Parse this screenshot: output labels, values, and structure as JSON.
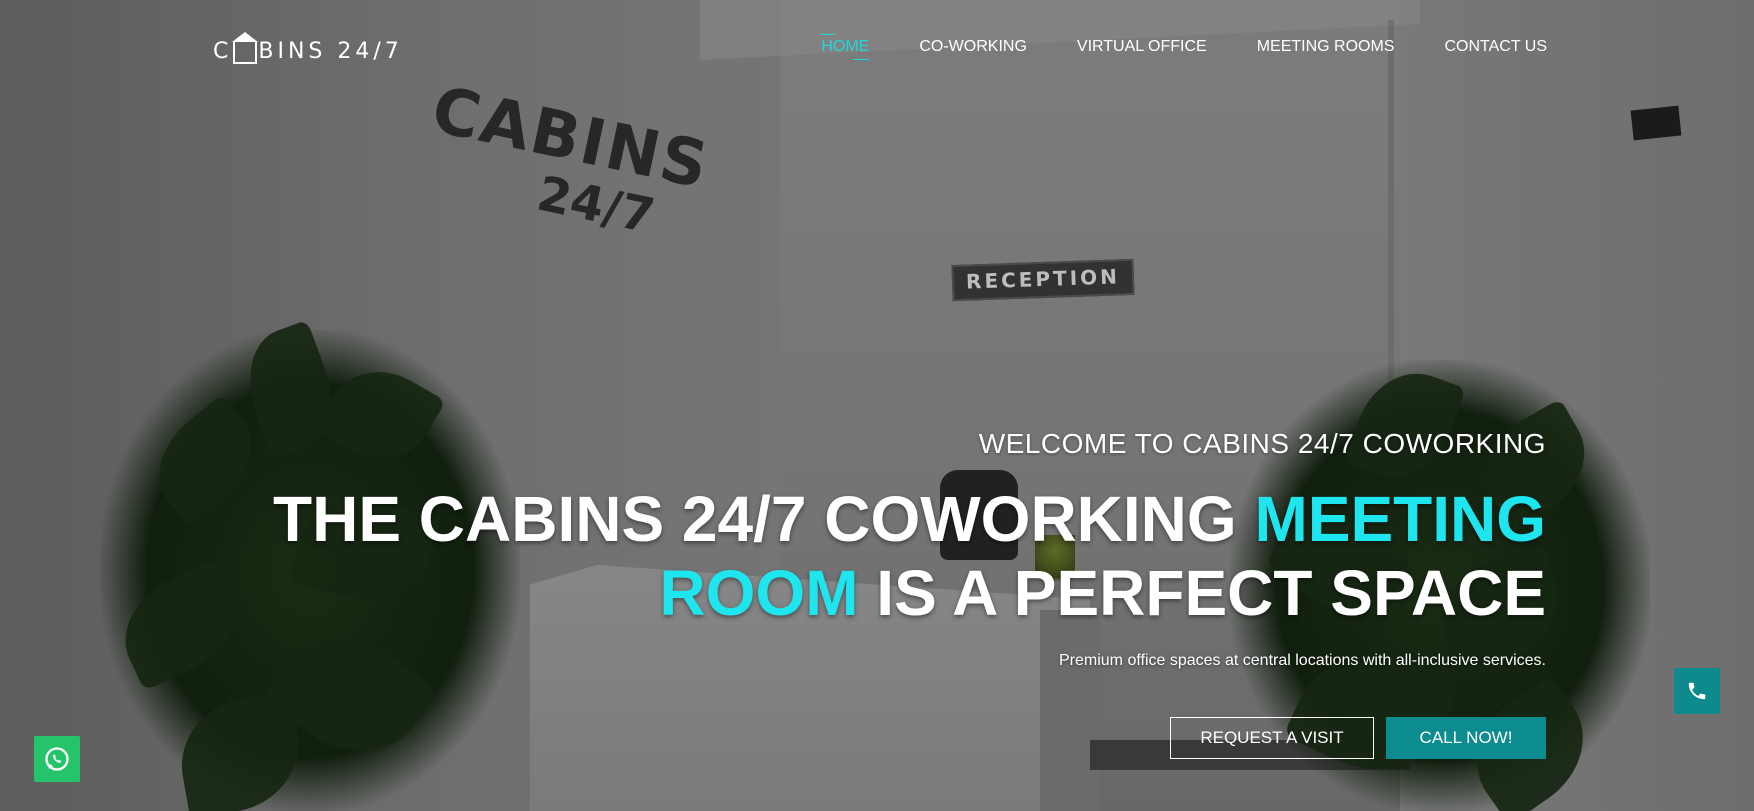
{
  "brand": {
    "logo_part1": "C",
    "logo_part2": "BINS 24/7"
  },
  "nav": {
    "items": [
      {
        "label": "HOME",
        "active": true
      },
      {
        "label": "CO-WORKING",
        "active": false
      },
      {
        "label": "VIRTUAL OFFICE",
        "active": false
      },
      {
        "label": "MEETING ROOMS",
        "active": false
      },
      {
        "label": "CONTACT US",
        "active": false
      }
    ]
  },
  "hero": {
    "welcome": "WELCOME TO CABINS 24/7 COWORKING",
    "headline_part1": "THE CABINS 24/7 COWORKING ",
    "headline_accent1": "MEETING",
    "headline_accent2": "ROOM",
    "headline_part2": " IS A PERFECT SPACE",
    "subline": "Premium office spaces at central locations with all-inclusive services.",
    "wall_sign_line1": "CABINS",
    "wall_sign_line2": "24/7",
    "reception_sign": "RECEPTION"
  },
  "buttons": {
    "request_visit": "REQUEST A VISIT",
    "call_now": "CALL NOW!"
  },
  "floating": {
    "phone_icon": "phone-icon",
    "whatsapp_icon": "whatsapp-icon"
  },
  "colors": {
    "accent": "#1fe6ee",
    "nav_active": "#1fd6e0",
    "call_button": "#0c8c8e",
    "whatsapp": "#25c46b"
  }
}
